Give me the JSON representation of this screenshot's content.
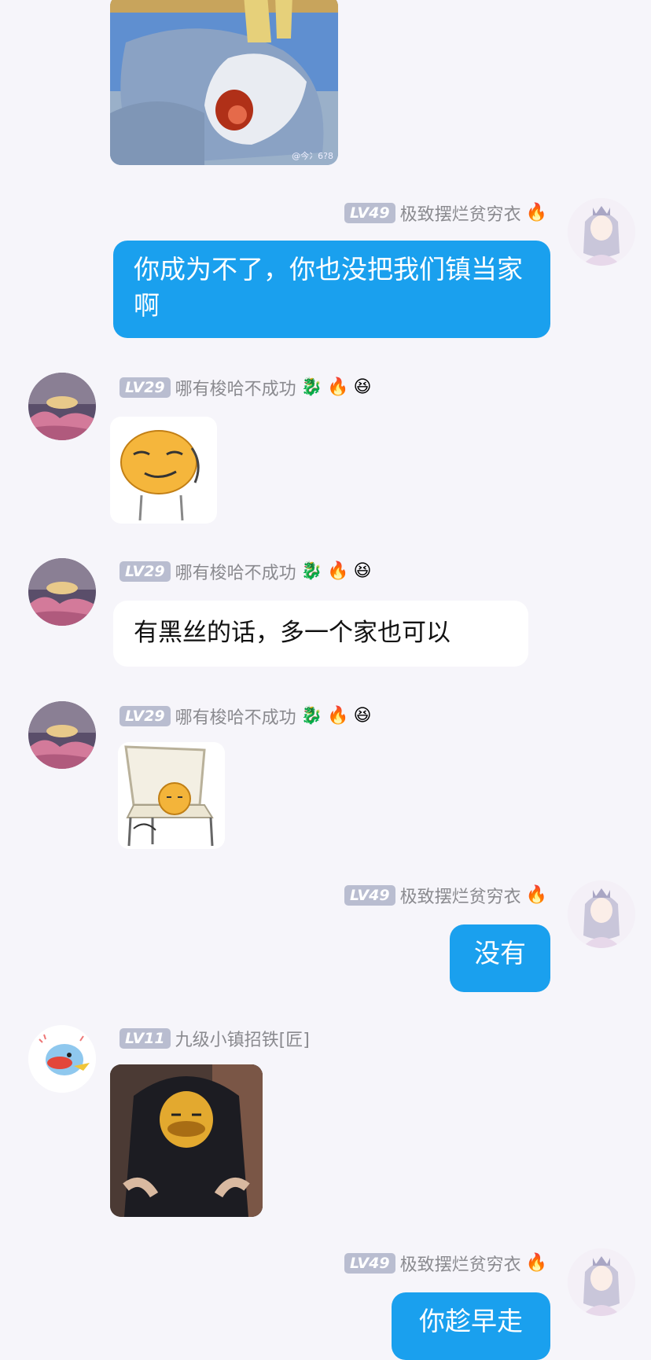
{
  "users": {
    "me": {
      "level": "LV49",
      "name": "极致摆烂贫穷衣",
      "badge": "🔥"
    },
    "u29": {
      "level": "LV29",
      "name": "哪有梭哈不成功",
      "badges": [
        "🐉",
        "🔥",
        "😆"
      ]
    },
    "u11": {
      "level": "LV11",
      "name": "九级小镇招铁[匠]"
    }
  },
  "messages": {
    "m1": {
      "text": "你成为不了，你也没把我们镇当家啊"
    },
    "m3": {
      "text": "有黑丝的话，多一个家也可以"
    },
    "m5": {
      "text": "没有"
    },
    "m7": {
      "text": "你趁早走"
    }
  },
  "image_watermark": "@今冫6?8"
}
